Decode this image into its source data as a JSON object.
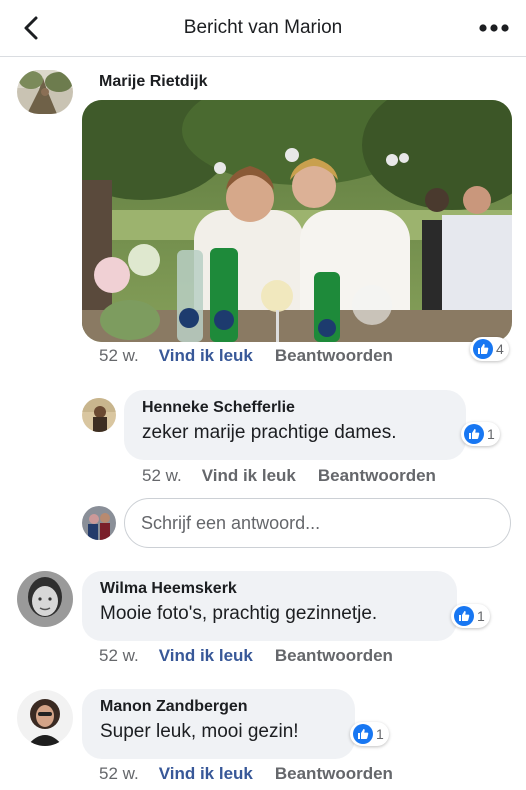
{
  "header": {
    "title": "Bericht van Marion"
  },
  "post": {
    "author": "Marije Rietdijk",
    "time": "52 w.",
    "like_label": "Vind ik leuk",
    "reply_label": "Beantwoorden",
    "reaction_count": "4"
  },
  "replies": [
    {
      "author": "Henneke Schefferlie",
      "text": "zeker marije prachtige dames.",
      "time": "52 w.",
      "like_label": "Vind ik leuk",
      "reply_label": "Beantwoorden",
      "reaction_count": "1"
    }
  ],
  "reply_input": {
    "placeholder": "Schrijf een antwoord..."
  },
  "comments": [
    {
      "author": "Wilma Heemskerk",
      "text": "Mooie foto's, prachtig gezinnetje.",
      "time": "52 w.",
      "like_label": "Vind ik leuk",
      "reply_label": "Beantwoorden",
      "reaction_count": "1"
    },
    {
      "author": "Manon Zandbergen",
      "text": "Super leuk, mooi gezin!",
      "time": "52 w.",
      "like_label": "Vind ik leuk",
      "reply_label": "Beantwoorden",
      "reaction_count": "1"
    }
  ],
  "colors": {
    "link_blue": "#385898",
    "like_blue": "#1877f2",
    "bubble_grey": "#f0f2f5",
    "meta_grey": "#65676b"
  },
  "icons": [
    "back-arrow-icon",
    "more-dots-icon",
    "thumbs-up-icon"
  ]
}
